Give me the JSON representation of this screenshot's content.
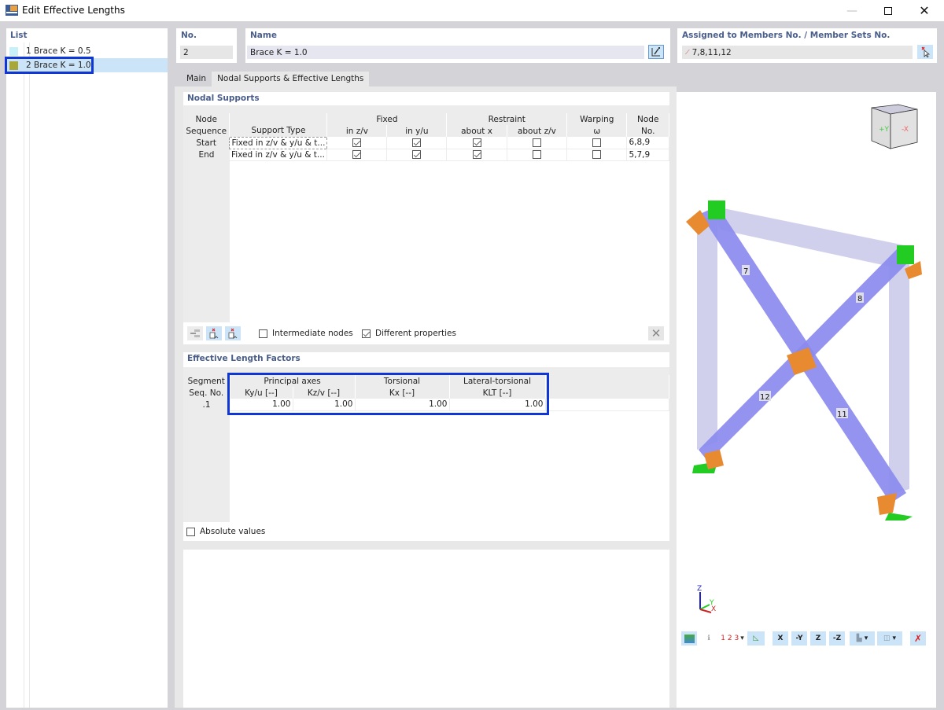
{
  "window": {
    "title": "Edit Effective Lengths",
    "minimize_icon": "minimize-icon",
    "maximize_icon": "maximize-icon",
    "close_icon": "close-icon"
  },
  "list": {
    "label": "List",
    "items": [
      {
        "label": "1 Brace K = 0.5",
        "color": "#c8f0f8",
        "selected": false
      },
      {
        "label": "2 Brace K = 1.0",
        "color": "#a8a83a",
        "selected": true
      }
    ]
  },
  "header": {
    "no_label": "No.",
    "no_value": "2",
    "name_label": "Name",
    "name_value": "Brace K = 1.0",
    "assigned_label": "Assigned to Members No. / Member Sets No.",
    "assigned_value": "7,8,11,12"
  },
  "tabs": [
    {
      "label": "Main",
      "active": false
    },
    {
      "label": "Nodal Supports & Effective Lengths",
      "active": true
    }
  ],
  "nodal_supports": {
    "title": "Nodal Supports",
    "group_headers": {
      "fixed": "Fixed",
      "restraint": "Restraint",
      "warping": "Warping",
      "node": "Node"
    },
    "columns": {
      "node_seq_1": "Node",
      "node_seq_2": "Sequence",
      "support_type": "Support Type",
      "in_zv": "in z/v",
      "in_yu": "in y/u",
      "about_x": "about x",
      "about_zv": "about z/v",
      "omega": "ω",
      "node_no": "No."
    },
    "rows": [
      {
        "seq": "Start",
        "support_type": "Fixed in z/v & y/u & t...",
        "in_zv": true,
        "in_yu": true,
        "about_x": true,
        "about_zv": false,
        "omega": false,
        "nodes": "6,8,9"
      },
      {
        "seq": "End",
        "support_type": "Fixed in z/v & y/u & t...",
        "in_zv": true,
        "in_yu": true,
        "about_x": true,
        "about_zv": false,
        "omega": false,
        "nodes": "5,7,9"
      }
    ],
    "intermediate_nodes_label": "Intermediate nodes",
    "intermediate_nodes_checked": false,
    "different_properties_label": "Different properties",
    "different_properties_checked": true
  },
  "effective_lengths": {
    "title": "Effective Length Factors",
    "group_headers": {
      "principal": "Principal axes",
      "torsional": "Torsional",
      "lateral": "Lateral-torsional"
    },
    "columns": {
      "seg_1": "Segment",
      "seg_2": "Seq. No.",
      "k_yu": "Ky/u [--]",
      "k_zv": "Kz/v [--]",
      "k_x": "Kx [--]",
      "k_lt": "KLT [--]"
    },
    "rows": [
      {
        "seq": ".1",
        "k_yu": "1.00",
        "k_zv": "1.00",
        "k_x": "1.00",
        "k_lt": "1.00"
      }
    ],
    "absolute_values_label": "Absolute values",
    "absolute_values_checked": false
  },
  "view": {
    "member_labels": [
      "7",
      "8",
      "11",
      "12"
    ],
    "cube_labels": {
      "front": "+Y",
      "right": "-X"
    },
    "axes": {
      "x": "X",
      "y": "Y",
      "z": "Z"
    },
    "local_axes": {
      "x": "x",
      "y": "y",
      "z": "z"
    },
    "toolbar": [
      {
        "icon": "display-settings-icon"
      },
      {
        "icon": "info-icon"
      },
      {
        "icon": "numbering-icon",
        "text": "1 2 3",
        "dropdown": true
      },
      {
        "icon": "view-visibility-icon"
      },
      {
        "icon": "view-x-icon",
        "text": "X"
      },
      {
        "icon": "view-neg-y-icon",
        "text": "-Y"
      },
      {
        "icon": "view-z-icon",
        "text": "Z"
      },
      {
        "icon": "view-neg-z-icon",
        "text": "-Z"
      },
      {
        "icon": "render-mode-icon",
        "dropdown": true
      },
      {
        "icon": "wireframe-cube-icon",
        "dropdown": true
      },
      {
        "icon": "reset-zoom-icon"
      }
    ]
  }
}
